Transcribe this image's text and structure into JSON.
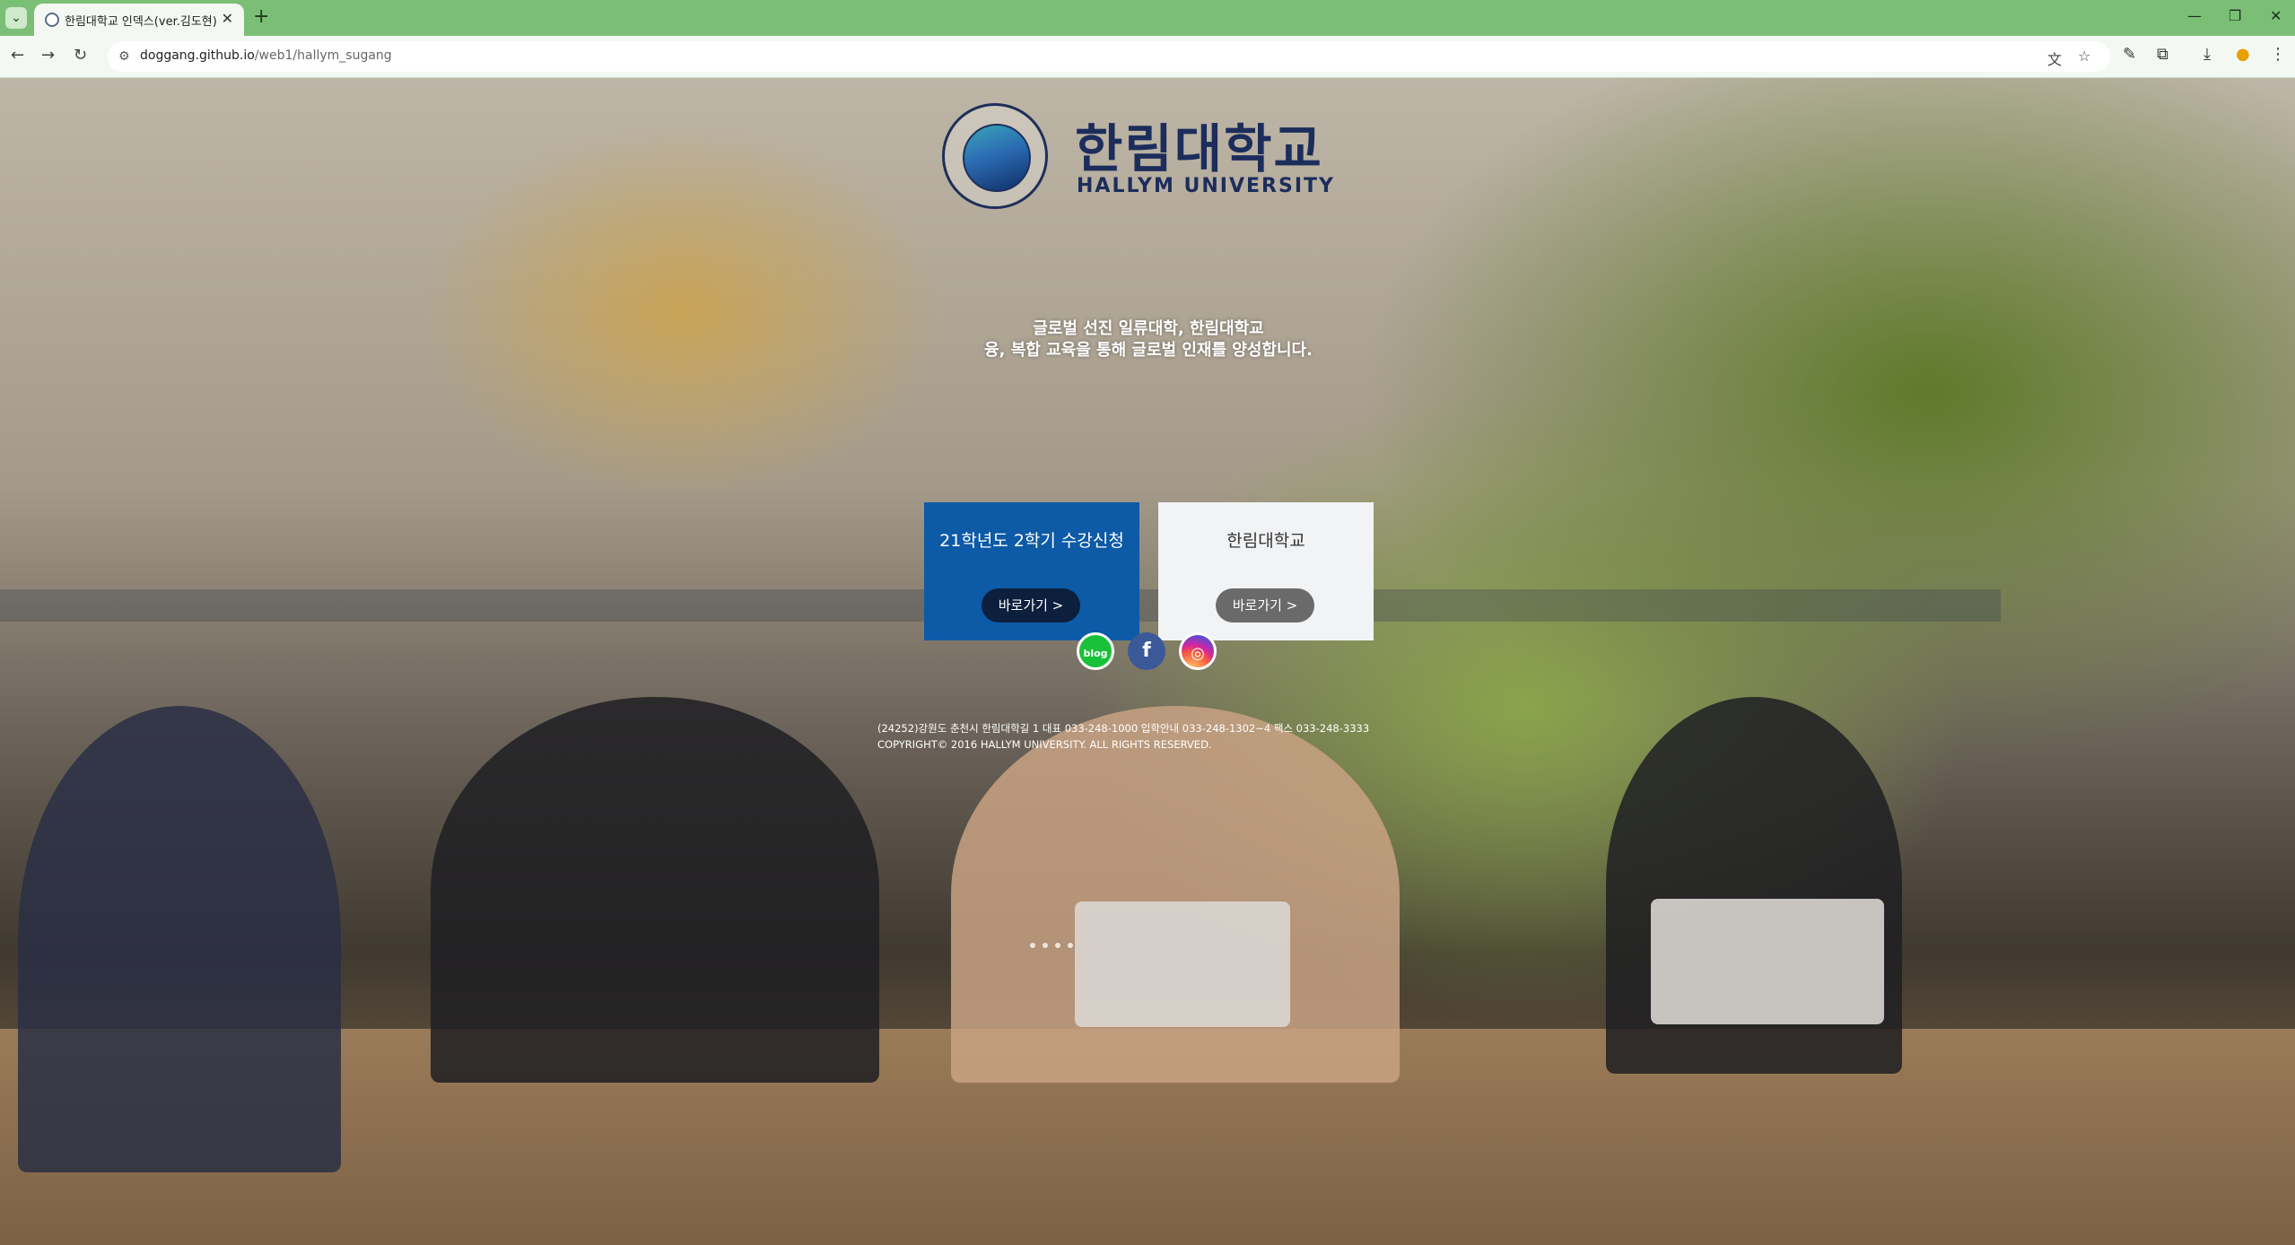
{
  "browser": {
    "tab_title": "한림대학교 인덱스(ver.김도현)",
    "new_tab": "+",
    "url_host": "doggang.github.io",
    "url_path": "/web1/hallym_sugang",
    "icons": [
      "tab-search-icon",
      "favicon",
      "close-icon",
      "new-tab-icon",
      "minimize-icon",
      "restore-icon",
      "close-window-icon",
      "back-icon",
      "forward-icon",
      "reload-icon",
      "site-info-icon",
      "translate-icon",
      "bookmark-star-icon",
      "edit-icon",
      "extensions-icon",
      "download-icon",
      "profile-icon",
      "menu-icon"
    ]
  },
  "hero": {
    "logo_ko": "한림대학교",
    "logo_en": "HALLYM UNIVERSITY",
    "seal_text": "HALLYM UNIVERSITY",
    "tagline_1": "글로벌 선진 일류대학, 한림대학교",
    "tagline_2": "융, 복합 교육을 통해 글로벌 인재를 양성합니다."
  },
  "cards": [
    {
      "title": "21학년도 2학기 수강신청",
      "button": "바로가기 >",
      "color": "#0d5aa6"
    },
    {
      "title": "한림대학교",
      "button": "바로가기 >",
      "color": "#f2f3f5"
    }
  ],
  "sns": {
    "blog": "blog",
    "facebook": "f",
    "instagram": "◎"
  },
  "footer": {
    "line1": "(24252)강원도 춘천시 한림대학길 1 대표 033-248-1000 입학안내 033-248-1302~4 팩스 033-248-3333",
    "line2": "COPYRIGHT© 2016 HALLYM UNIVERSITY. ALL RIGHTS RESERVED."
  },
  "slider": {
    "dot_count": 4
  }
}
